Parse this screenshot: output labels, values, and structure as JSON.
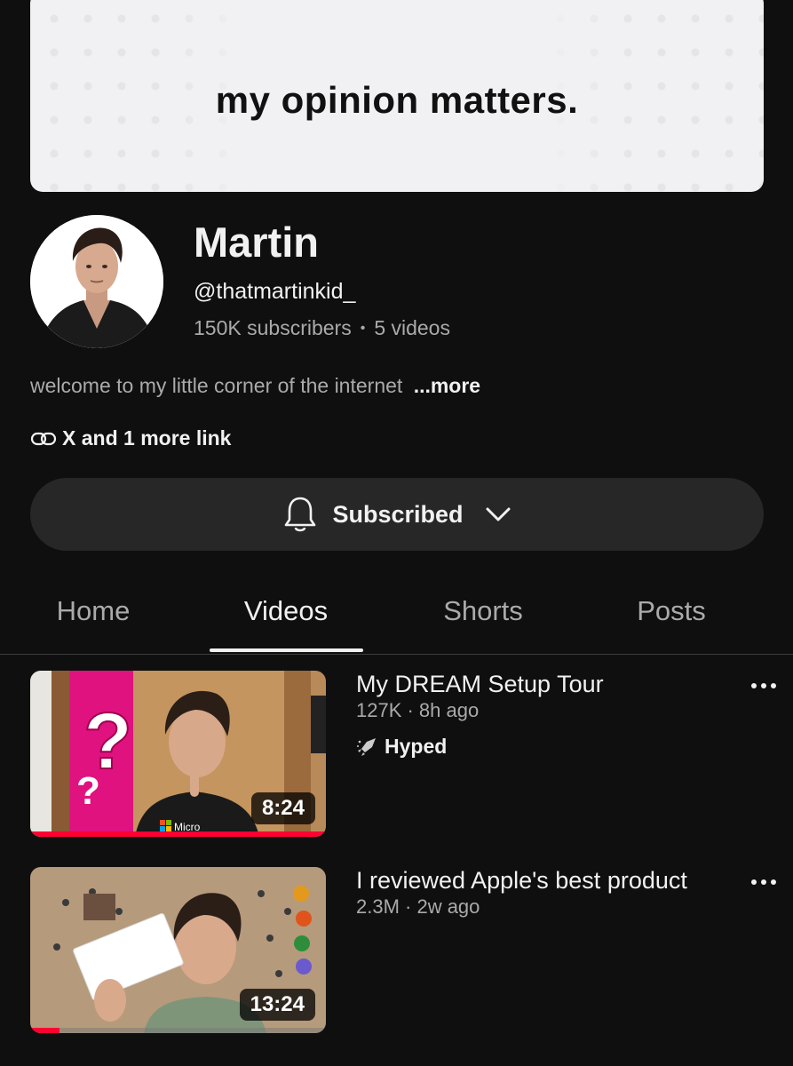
{
  "banner": {
    "text": "my opinion matters."
  },
  "channel": {
    "name": "Martin",
    "handle": "@thatmartinkid_",
    "subscribers": "150K subscribers",
    "separator": "•",
    "videos": "5 videos",
    "description": "welcome to my little corner of the internet",
    "more": "...more",
    "links": "X and 1 more link"
  },
  "subscribe": {
    "label": "Subscribed",
    "icon": "bell-icon",
    "dropdown_icon": "chevron-down-icon"
  },
  "tabs": [
    {
      "label": "Home",
      "active": false
    },
    {
      "label": "Videos",
      "active": true
    },
    {
      "label": "Shorts",
      "active": false
    },
    {
      "label": "Posts",
      "active": false
    }
  ],
  "videos": [
    {
      "title": "My DREAM Setup Tour",
      "meta": "127K · 8h ago",
      "badge": "Hyped",
      "badge_icon": "hyped-rocket-icon",
      "duration": "8:24",
      "progress": 1.0
    },
    {
      "title": "I reviewed Apple's best product",
      "meta": "2.3M · 2w ago",
      "duration": "13:24",
      "progress": 0.1
    }
  ],
  "colors": {
    "background": "#0f0f0f",
    "text": "#f1f1f1",
    "secondary_text": "#aaaaaa",
    "button_bg": "#272727",
    "progress": "#ff0033"
  }
}
